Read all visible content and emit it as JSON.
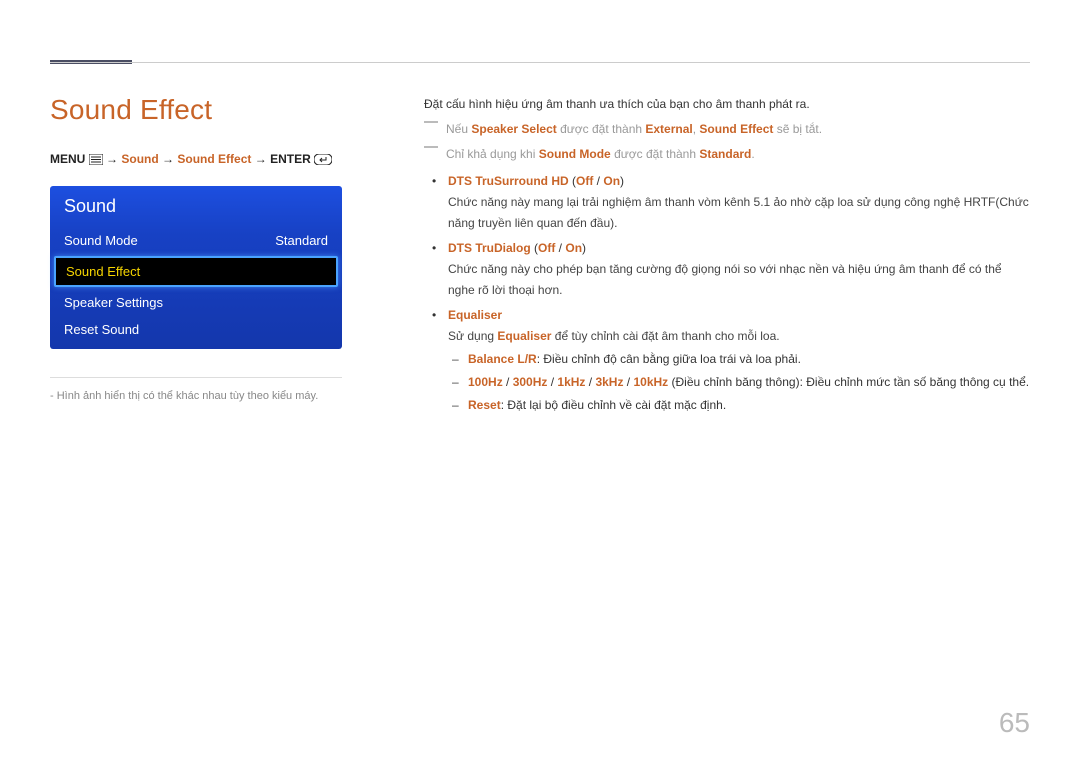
{
  "page_number": "65",
  "title": "Sound Effect",
  "breadcrumb": {
    "menu": "MENU",
    "arrow": "→",
    "p1": "Sound",
    "p2": "Sound Effect",
    "enter": "ENTER"
  },
  "tv": {
    "header": "Sound",
    "rows": [
      {
        "label": "Sound Mode",
        "value": "Standard",
        "selected": false
      },
      {
        "label": "Sound Effect",
        "value": "",
        "selected": true
      },
      {
        "label": "Speaker Settings",
        "value": "",
        "selected": false
      },
      {
        "label": "Reset Sound",
        "value": "",
        "selected": false
      }
    ]
  },
  "footnote_prefix": "-",
  "footnote": "Hình ảnh hiển thị có thể khác nhau tùy theo kiểu máy.",
  "right": {
    "intro": "Đặt cấu hình hiệu ứng âm thanh ưa thích của bạn cho âm thanh phát ra.",
    "note1_a": "Nếu ",
    "note1_b": "Speaker Select",
    "note1_c": " được đặt thành ",
    "note1_d": "External",
    "note1_e": ", ",
    "note1_f": "Sound Effect",
    "note1_g": " sẽ bị tắt.",
    "note2_a": "Chỉ khả dụng khi ",
    "note2_b": "Sound Mode",
    "note2_c": " được đặt thành ",
    "note2_d": "Standard",
    "note2_e": ".",
    "feat": [
      {
        "name": "DTS TruSurround HD",
        "opts_open": "(",
        "off": "Off",
        "sep": " / ",
        "on": "On",
        "opts_close": ")",
        "desc": "Chức năng này mang lại trải nghiệm âm thanh vòm kênh 5.1 ảo nhờ cặp loa sử dụng công nghệ HRTF(Chức năng truyền liên quan đến đầu)."
      },
      {
        "name": "DTS TruDialog",
        "opts_open": "(",
        "off": "Off",
        "sep": " / ",
        "on": "On",
        "opts_close": ")",
        "desc": "Chức năng này cho phép bạn tăng cường độ giọng nói so với nhạc nền và hiệu ứng âm thanh để có thể nghe rõ lời thoại hơn."
      },
      {
        "name": "Equaliser",
        "desc_a": "Sử dụng ",
        "desc_b": "Equaliser",
        "desc_c": " để tùy chỉnh cài đặt âm thanh cho mỗi loa.",
        "sub": [
          {
            "name": "Balance L/R",
            "text": ": Điều chỉnh độ cân bằng giữa loa trái và loa phải."
          },
          {
            "hz": [
              "100Hz",
              "300Hz",
              "1kHz",
              "3kHz",
              "10kHz"
            ],
            "sep": " / ",
            "tail_a": " (Điều chỉnh băng thông): Điều chỉnh mức tần số băng thông cụ thể."
          },
          {
            "name": "Reset",
            "text": ": Đặt lại bộ điều chỉnh về cài đặt mặc định."
          }
        ]
      }
    ]
  }
}
